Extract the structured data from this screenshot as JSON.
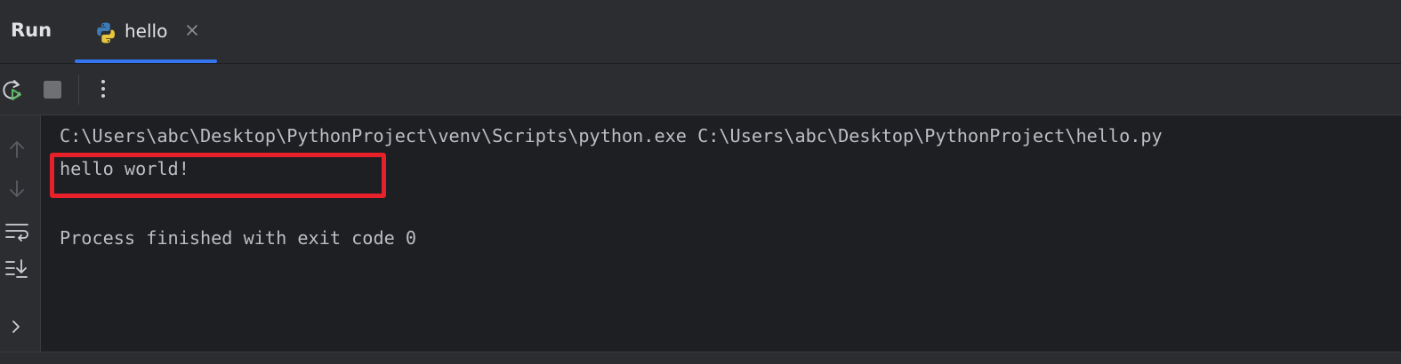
{
  "header": {
    "title": "Run",
    "tab": {
      "label": "hello",
      "icon": "python-file-icon",
      "close_icon": "close-icon",
      "active": true
    }
  },
  "toolbar": {
    "buttons": [
      {
        "name": "rerun-button",
        "icon": "rerun-icon"
      },
      {
        "name": "stop-button",
        "icon": "stop-icon"
      },
      {
        "name": "more-options-button",
        "icon": "more-vertical-icon"
      }
    ]
  },
  "gutter": {
    "buttons": [
      {
        "name": "scroll-up-button",
        "icon": "arrow-up-icon"
      },
      {
        "name": "scroll-down-button",
        "icon": "arrow-down-icon"
      },
      {
        "name": "soft-wrap-button",
        "icon": "soft-wrap-icon"
      },
      {
        "name": "scroll-to-end-button",
        "icon": "scroll-to-end-icon"
      },
      {
        "name": "expand-button",
        "icon": "chevron-right-icon"
      }
    ]
  },
  "console": {
    "command_line": "C:\\Users\\abc\\Desktop\\PythonProject\\venv\\Scripts\\python.exe C:\\Users\\abc\\Desktop\\PythonProject\\hello.py",
    "output_line": "hello world!",
    "status_line": "Process finished with exit code 0"
  },
  "colors": {
    "accent": "#3574f0",
    "highlight_border": "#e8202a",
    "background": "#1e1f22",
    "panel": "#2b2d30",
    "text": "#bcbec4"
  }
}
